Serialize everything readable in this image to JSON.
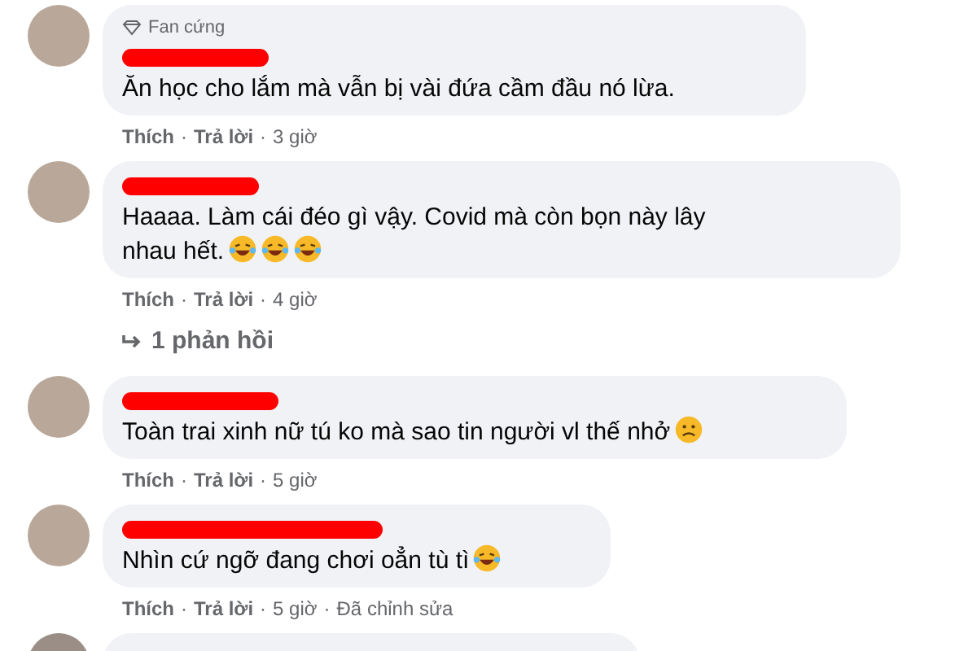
{
  "comments": [
    {
      "badge": "Fan cứng",
      "text": "Ăn học cho lắm mà vẫn bị vài đứa cầm đầu nó lừa.",
      "footer": [
        {
          "kind": "action",
          "text": "Thích"
        },
        {
          "kind": "dot",
          "text": "·"
        },
        {
          "kind": "action",
          "text": "Trả lời"
        },
        {
          "kind": "dot",
          "text": "·"
        },
        {
          "kind": "time",
          "text": "3 giờ"
        }
      ]
    },
    {
      "text": "Haaaa. Làm cái đéo gì vậy. Covid mà còn bọn này lây nhau hết.",
      "emojis": [
        {
          "kind": "rofl"
        },
        {
          "kind": "rofl"
        },
        {
          "kind": "rofl"
        }
      ],
      "footer": [
        {
          "kind": "action",
          "text": "Thích"
        },
        {
          "kind": "dot",
          "text": "·"
        },
        {
          "kind": "action",
          "text": "Trả lời"
        },
        {
          "kind": "dot",
          "text": "·"
        },
        {
          "kind": "time",
          "text": "4 giờ"
        }
      ],
      "replies": "1 phản hồi"
    },
    {
      "text": "Toàn trai xinh nữ tú ko mà sao tin người vl thế nhở",
      "emojis": [
        {
          "kind": "sad"
        }
      ],
      "footer": [
        {
          "kind": "action",
          "text": "Thích"
        },
        {
          "kind": "dot",
          "text": "·"
        },
        {
          "kind": "action",
          "text": "Trả lời"
        },
        {
          "kind": "dot",
          "text": "·"
        },
        {
          "kind": "time",
          "text": "5 giờ"
        }
      ]
    },
    {
      "text": "Nhìn cứ ngỡ đang chơi oẳn tù tì",
      "emojis": [
        {
          "kind": "joy"
        }
      ],
      "footer": [
        {
          "kind": "action",
          "text": "Thích"
        },
        {
          "kind": "dot",
          "text": "·"
        },
        {
          "kind": "action",
          "text": "Trả lời"
        },
        {
          "kind": "dot",
          "text": "·"
        },
        {
          "kind": "time",
          "text": "5 giờ"
        },
        {
          "kind": "dot",
          "text": "·"
        },
        {
          "kind": "note",
          "text": "Đã chỉnh sửa"
        }
      ]
    }
  ]
}
